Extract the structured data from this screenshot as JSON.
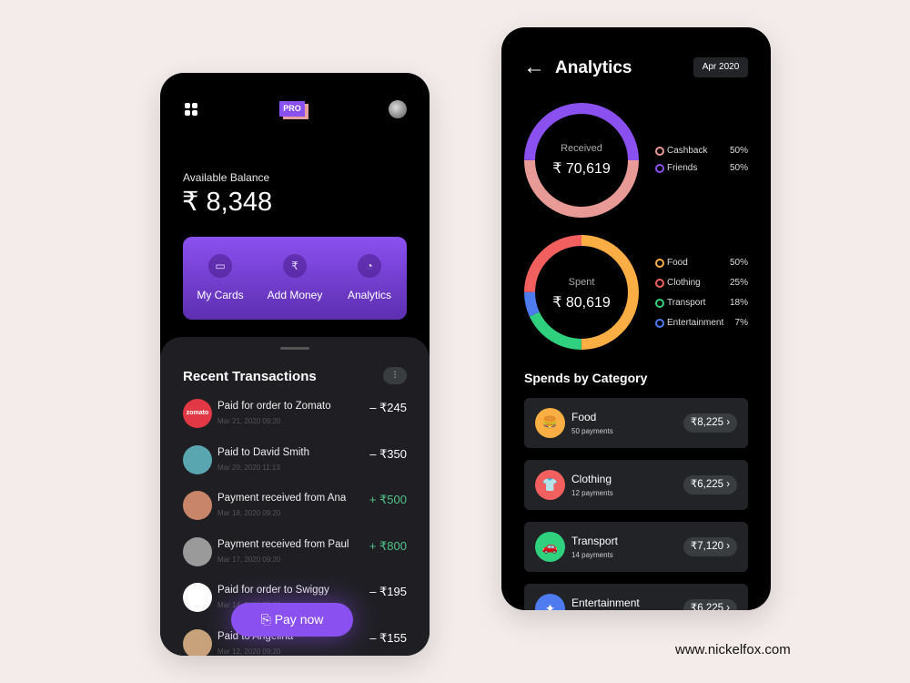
{
  "home": {
    "badge": "PRO",
    "balance_label": "Available Balance",
    "balance": "₹ 8,348",
    "actions": [
      {
        "label": "My Cards",
        "icon": "card-icon"
      },
      {
        "label": "Add Money",
        "icon": "add-money-icon"
      },
      {
        "label": "Analytics",
        "icon": "pie-chart-icon"
      }
    ],
    "recent_title": "Recent Transactions",
    "transactions": [
      {
        "title": "Paid for order to Zomato",
        "date": "Mar 21, 2020 09:20",
        "amount": "– ₹245",
        "type": "debit",
        "avatar_text": "zomato",
        "color": "#e23744"
      },
      {
        "title": "Paid to David Smith",
        "date": "Mar 20, 2020 11:13",
        "amount": "– ₹350",
        "type": "debit",
        "color": "#5aa6b0"
      },
      {
        "title": "Payment received from Ana",
        "date": "Mar 18, 2020 09:20",
        "amount": "+ ₹500",
        "type": "credit",
        "color": "#c9856a"
      },
      {
        "title": "Payment received from Paul",
        "date": "Mar 17, 2020 09:20",
        "amount": "+ ₹800",
        "type": "credit",
        "color": "#9a9a9a"
      },
      {
        "title": "Paid for order to Swiggy",
        "date": "Mar 14, 2020 09:20",
        "amount": "– ₹195",
        "type": "debit",
        "color": "#ffffff"
      },
      {
        "title": "Paid to Angelina",
        "date": "Mar 12, 2020 09:20",
        "amount": "– ₹155",
        "type": "debit",
        "color": "#c8a27a"
      }
    ],
    "pay_label": "Pay now"
  },
  "analytics": {
    "title": "Analytics",
    "month": "Apr 2020",
    "received": {
      "label": "Received",
      "amount": "₹ 70,619",
      "segments": [
        {
          "name": "Cashback",
          "pct": "50%",
          "value": 50,
          "color": "#e79a96"
        },
        {
          "name": "Friends",
          "pct": "50%",
          "value": 50,
          "color": "#8b50f0"
        }
      ]
    },
    "spent": {
      "label": "Spent",
      "amount": "₹ 80,619",
      "segments": [
        {
          "name": "Food",
          "pct": "50%",
          "value": 50,
          "color": "#fbae44"
        },
        {
          "name": "Clothing",
          "pct": "25%",
          "value": 25,
          "color": "#f1605f"
        },
        {
          "name": "Transport",
          "pct": "18%",
          "value": 18,
          "color": "#2fd17e"
        },
        {
          "name": "Entertainment",
          "pct": "7%",
          "value": 7,
          "color": "#4e7bf0"
        }
      ]
    },
    "spends_title": "Spends by Category",
    "categories": [
      {
        "name": "Food",
        "payments": "50 payments",
        "amount": "₹8,225",
        "color": "#fbae44",
        "icon": "burger-icon"
      },
      {
        "name": "Clothing",
        "payments": "12 payments",
        "amount": "₹6,225",
        "color": "#f1605f",
        "icon": "shirt-icon"
      },
      {
        "name": "Transport",
        "payments": "14 payments",
        "amount": "₹7,120",
        "color": "#2fd17e",
        "icon": "car-icon"
      },
      {
        "name": "Entertainment",
        "payments": "",
        "amount": "₹6,225",
        "color": "#4e7bf0",
        "icon": "entertainment-icon"
      }
    ]
  },
  "footer": {
    "site": "www.nickelfox.com"
  }
}
